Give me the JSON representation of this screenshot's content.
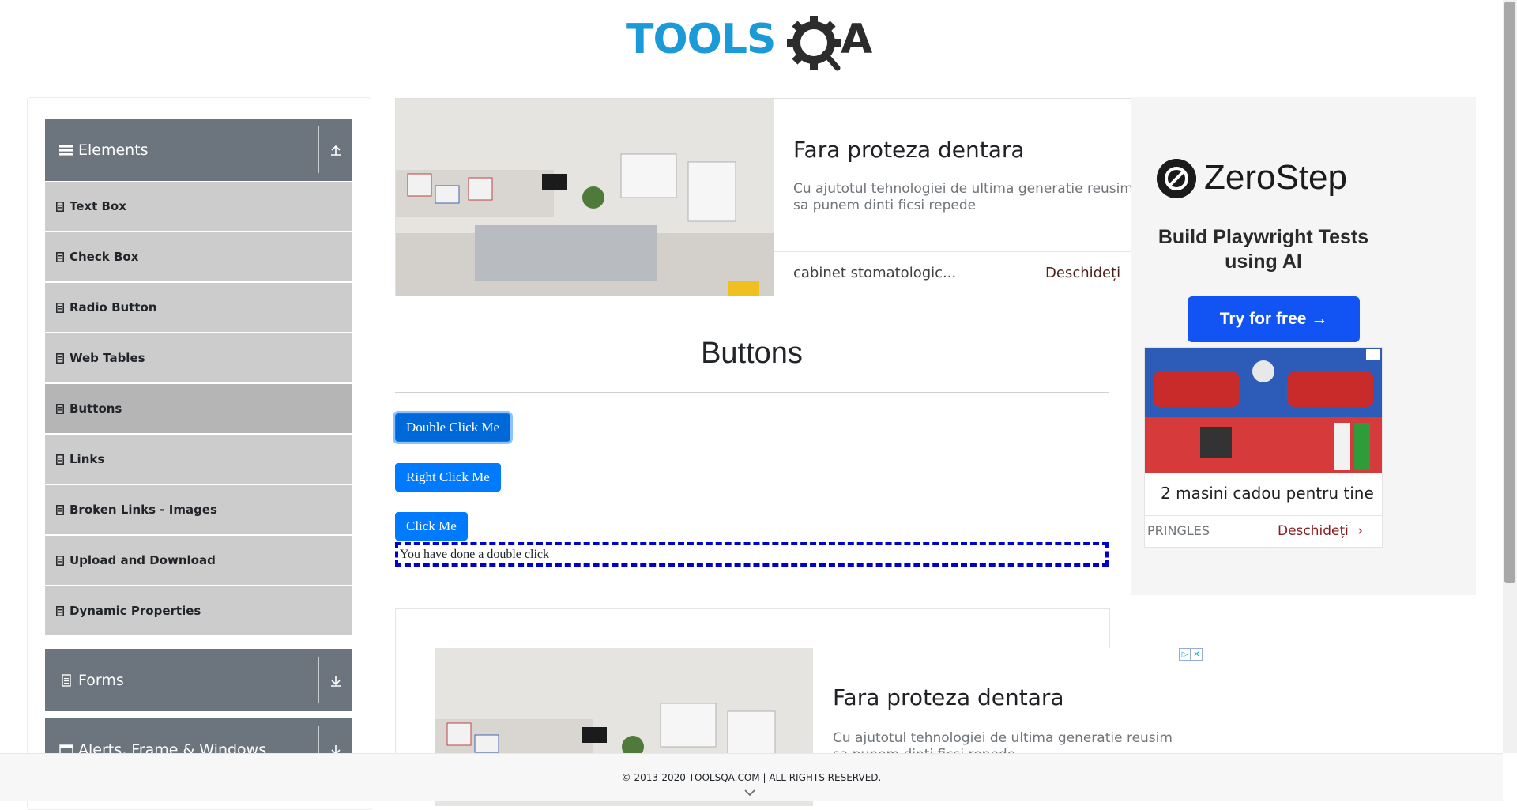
{
  "header": {
    "logo_text": "TOOLSQA"
  },
  "sidebar": {
    "groups": [
      {
        "label": "Elements",
        "icon": "hamburger-icon",
        "toggle": "collapse-up-icon"
      },
      {
        "label": "Forms",
        "icon": "document-icon",
        "toggle": "expand-down-icon"
      },
      {
        "label": "Alerts, Frame & Windows",
        "icon": "window-icon",
        "toggle": "expand-down-icon"
      }
    ],
    "items": [
      {
        "label": "Text Box"
      },
      {
        "label": "Check Box"
      },
      {
        "label": "Radio Button"
      },
      {
        "label": "Web Tables"
      },
      {
        "label": "Buttons",
        "active": true
      },
      {
        "label": "Links"
      },
      {
        "label": "Broken Links - Images"
      },
      {
        "label": "Upload and Download"
      },
      {
        "label": "Dynamic Properties"
      }
    ]
  },
  "ad_top": {
    "title": "Fara proteza dentara",
    "description": "Cu ajutotul tehnologiei de ultima generatie reusim sa punem dinti ficsi repede",
    "source": "cabinet stomatologic...",
    "open_label": "Deschideți"
  },
  "main": {
    "title": "Buttons",
    "buttons": {
      "double_click": "Double Click Me",
      "right_click": "Right Click Me",
      "click": "Click Me"
    },
    "result_message": "You have done a double click"
  },
  "ad_bottom": {
    "title": "Fara proteza dentara",
    "description": "Cu ajutotul tehnologiei de ultima generatie reusim sa punem dinti ficsi repede"
  },
  "ad_right": {
    "brand": "ZeroStep",
    "tagline": "Build Playwright Tests using AI",
    "cta": "Try for free →",
    "promo_title": "2 masini cadou pentru tine",
    "promo_source": "PRINGLES",
    "promo_open": "Deschideți"
  },
  "footer": {
    "copyright": "© 2013-2020 TOOLSQA.COM | ALL RIGHTS RESERVED."
  },
  "colors": {
    "brand_blue": "#1a9ad6",
    "button_blue": "#007bff",
    "sidebar_header": "#6c757d",
    "sidebar_item": "#cccccc",
    "cta_blue": "#1254f3"
  }
}
